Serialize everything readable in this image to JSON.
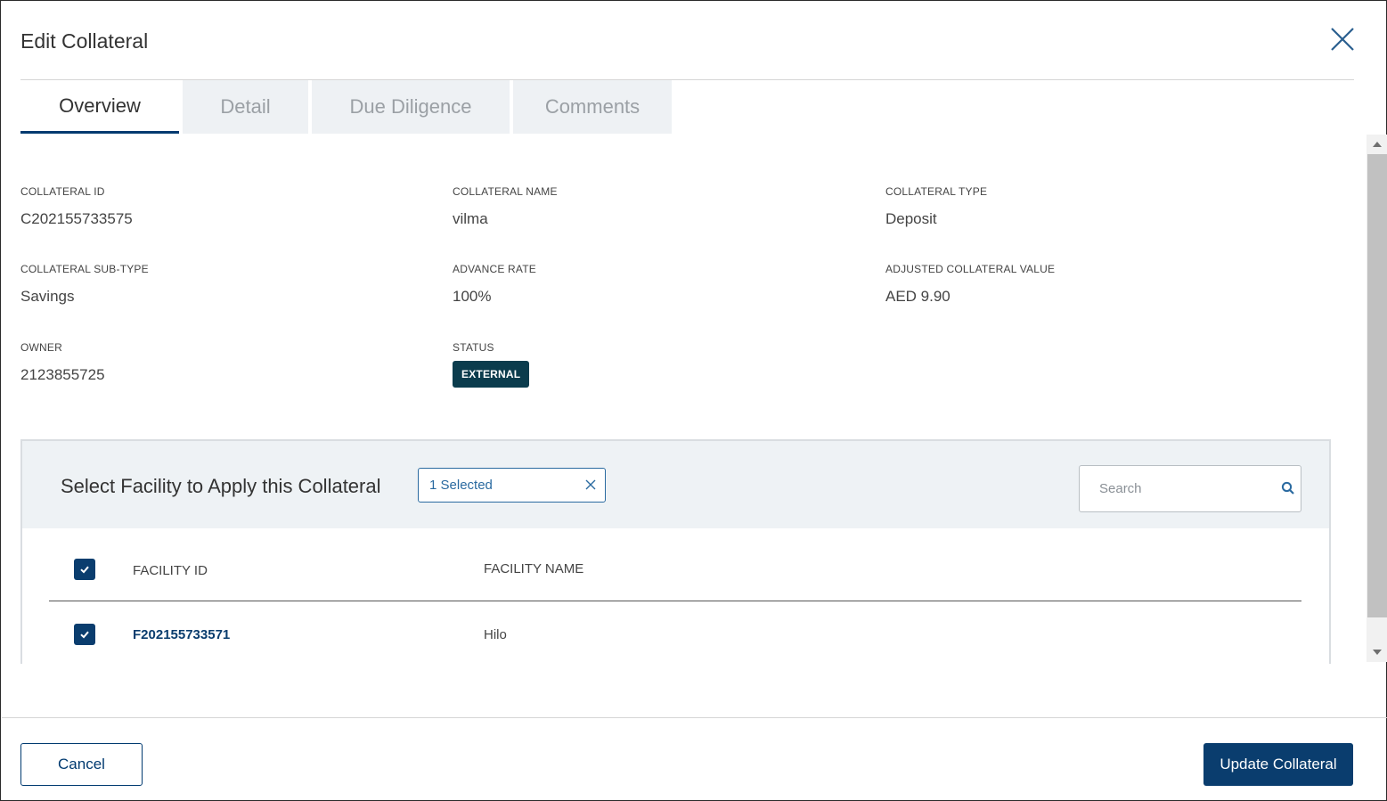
{
  "dialog": {
    "title": "Edit Collateral",
    "close_icon": "close-icon"
  },
  "tabs": [
    {
      "label": "Overview",
      "active": true
    },
    {
      "label": "Detail",
      "active": false
    },
    {
      "label": "Due Diligence",
      "active": false
    },
    {
      "label": "Comments",
      "active": false
    }
  ],
  "overview": {
    "collateral_id": {
      "label": "COLLATERAL ID",
      "value": "C202155733575"
    },
    "collateral_name": {
      "label": "COLLATERAL NAME",
      "value": "vilma"
    },
    "collateral_type": {
      "label": "COLLATERAL TYPE",
      "value": "Deposit"
    },
    "collateral_sub_type": {
      "label": "COLLATERAL SUB-TYPE",
      "value": "Savings"
    },
    "advance_rate": {
      "label": "ADVANCE RATE",
      "value": "100%"
    },
    "adjusted_value": {
      "label": "ADJUSTED COLLATERAL VALUE",
      "value": "AED 9.90"
    },
    "owner": {
      "label": "OWNER",
      "value": "2123855725"
    },
    "status": {
      "label": "STATUS",
      "value": "EXTERNAL"
    }
  },
  "facility_panel": {
    "title": "Select Facility to Apply this Collateral",
    "selected_chip": "1 Selected",
    "search_placeholder": "Search",
    "columns": {
      "id": "FACILITY ID",
      "name": "FACILITY NAME"
    },
    "rows": [
      {
        "id": "F202155733571",
        "name": "Hilo",
        "checked": true
      }
    ],
    "header_checked": true
  },
  "footer": {
    "cancel_label": "Cancel",
    "update_label": "Update Collateral"
  },
  "colors": {
    "primary": "#0a3d6e",
    "badge_bg": "#0b3c4d",
    "tab_inactive_bg": "#eef1f4",
    "panel_head_bg": "#eef2f5"
  }
}
